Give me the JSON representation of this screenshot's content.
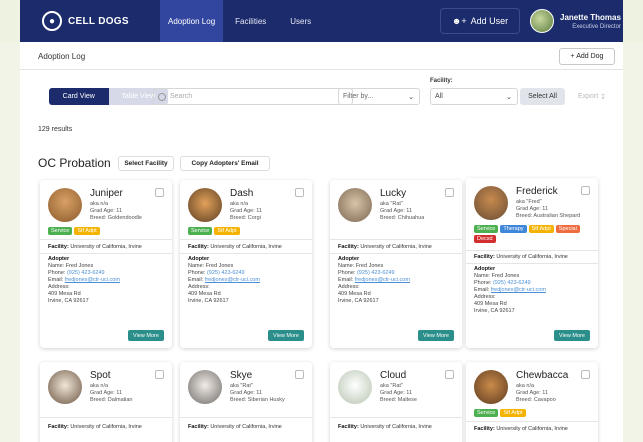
{
  "app": {
    "logo_text": "CELL DOGS"
  },
  "nav": {
    "tabs": [
      {
        "label": "Adoption Log",
        "active": true
      },
      {
        "label": "Facilities",
        "active": false
      },
      {
        "label": "Users",
        "active": false
      }
    ],
    "add_user_label": "Add User",
    "user": {
      "name": "Janette Thomas",
      "role": "Executive Director"
    }
  },
  "subheader": {
    "title": "Adoption Log",
    "add_dog_label": "+ Add Dog"
  },
  "filters": {
    "card_view_label": "Card View",
    "table_view_label": "Table View",
    "search_placeholder": "Search",
    "filter_by_label": "Filter by...",
    "facility_label": "Facility:",
    "facility_value": "All",
    "select_all_label": "Select All",
    "export_label": "Export"
  },
  "results": "129 results",
  "section": {
    "title": "OC Probation",
    "select_facility_label": "Select Facility",
    "copy_emails_label": "Copy Adopters' Email"
  },
  "colors": {
    "nav_bg": "#1b2b6b",
    "view_more": "#2a8f8a",
    "link": "#4a8fd6"
  },
  "cards": [
    {
      "name": "Juniper",
      "aka": "aka n/a",
      "grad_age": "Grad Age: 11",
      "breed": "Breed: Goldendoodle",
      "tags": [
        {
          "label": "Service",
          "type": "service"
        },
        {
          "label": "Stf Adpt",
          "type": "sit"
        }
      ],
      "facility_key": "Facility:",
      "facility_val": "University of California, Irvine",
      "adopter_title": "Adopter",
      "adopter_name": "Name: Fred Jones",
      "phone_label": "Phone:",
      "phone": "(925) 423-6249",
      "email_label": "Email:",
      "email": "fredjones@ctr-uci.com",
      "address_label": "Address:",
      "address1": "409 Mesa Rd",
      "address2": "Irvine, CA 92617",
      "view_more": "View More"
    },
    {
      "name": "Dash",
      "aka": "aka n/a",
      "grad_age": "Grad Age: 11",
      "breed": "Breed: Corgi",
      "tags": [
        {
          "label": "Service",
          "type": "service"
        },
        {
          "label": "Stf Adpt",
          "type": "sit"
        }
      ],
      "facility_key": "Facility:",
      "facility_val": "University of California, Irvine",
      "adopter_title": "Adopter",
      "adopter_name": "Name: Fred Jones",
      "phone_label": "Phone:",
      "phone": "(925) 423-6249",
      "email_label": "Email:",
      "email": "fredjones@ctr-uci.com",
      "address_label": "Address:",
      "address1": "409 Mesa Rd",
      "address2": "Irvine, CA 92617",
      "view_more": "View More"
    },
    {
      "name": "Lucky",
      "aka": "aka \"Rat\"",
      "grad_age": "Grad Age: 11",
      "breed": "Breed: Chihuahua",
      "tags": [],
      "facility_key": "Facility:",
      "facility_val": "University of California, Irvine",
      "adopter_title": "Adopter",
      "adopter_name": "Name: Fred Jones",
      "phone_label": "Phone:",
      "phone": "(925) 423-6249",
      "email_label": "Email:",
      "email": "fredjones@ctr-uci.com",
      "address_label": "Address:",
      "address1": "409 Mesa Rd",
      "address2": "Irvine, CA 92617",
      "view_more": "View More"
    },
    {
      "name": "Frederick",
      "aka": "aka \"Fred\"",
      "grad_age": "Grad Age: 11",
      "breed": "Breed: Australian Shepard",
      "tags": [
        {
          "label": "Service",
          "type": "service"
        },
        {
          "label": "Therapy",
          "type": "therapy"
        },
        {
          "label": "Stf Adpt",
          "type": "sit"
        },
        {
          "label": "Special",
          "type": "special"
        },
        {
          "label": "Decsd",
          "type": "decsd"
        }
      ],
      "facility_key": "Facility:",
      "facility_val": "University of California, Irvine",
      "adopter_title": "Adopter",
      "adopter_name": "Name: Fred Jones",
      "phone_label": "Phone:",
      "phone": "(925) 423-6249",
      "email_label": "Email:",
      "email": "fredjones@ctr-uci.com",
      "address_label": "Address:",
      "address1": "409 Mesa Rd",
      "address2": "Irvine, CA 92617",
      "view_more": "View More"
    },
    {
      "name": "Spot",
      "aka": "aka n/a",
      "grad_age": "Grad Age: 11",
      "breed": "Breed: Dalmatian",
      "tags": [],
      "facility_key": "Facility:",
      "facility_val": "University of California, Irvine"
    },
    {
      "name": "Skye",
      "aka": "aka \"Rat\"",
      "grad_age": "Grad Age: 11",
      "breed": "Breed: Siberian Husky",
      "tags": [],
      "facility_key": "Facility:",
      "facility_val": "University of California, Irvine"
    },
    {
      "name": "Cloud",
      "aka": "aka \"Rat\"",
      "grad_age": "Grad Age: 11",
      "breed": "Breed: Maltese",
      "tags": [],
      "facility_key": "Facility:",
      "facility_val": "University of California, Irvine"
    },
    {
      "name": "Chewbacca",
      "aka": "aka n/a",
      "grad_age": "Grad Age: 11",
      "breed": "Breed: Cavapoo",
      "tags": [
        {
          "label": "Service",
          "type": "service"
        },
        {
          "label": "Stf Adpt",
          "type": "sit"
        }
      ],
      "facility_key": "Facility:",
      "facility_val": "University of California, Irvine"
    }
  ]
}
